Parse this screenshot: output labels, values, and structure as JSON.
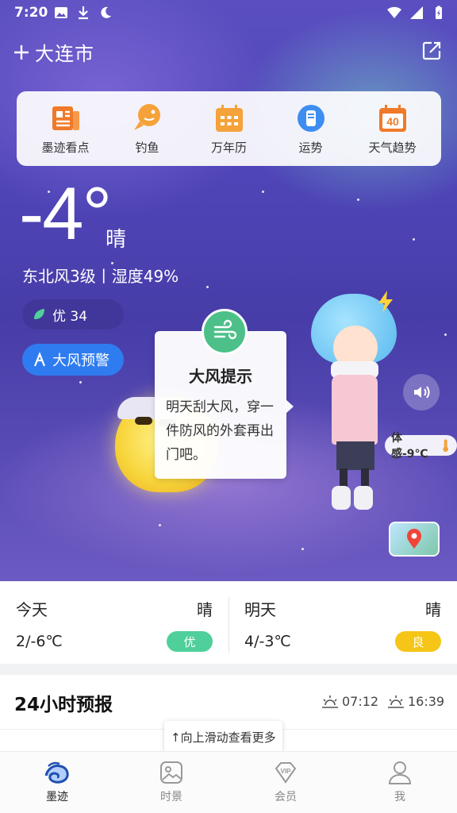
{
  "status_bar": {
    "time": "7:20"
  },
  "header": {
    "city": "大连市"
  },
  "shortcuts": [
    {
      "label": "墨迹看点",
      "icon": "news-icon"
    },
    {
      "label": "钓鱼",
      "icon": "fish-icon"
    },
    {
      "label": "万年历",
      "icon": "calendar-icon"
    },
    {
      "label": "运势",
      "icon": "fortune-icon"
    },
    {
      "label": "天气趋势",
      "icon": "trend-40-icon"
    }
  ],
  "shortcut_badge": "40",
  "current": {
    "temperature": "-4°",
    "condition": "晴",
    "wind_humidity": "东北风3级丨湿度49%",
    "aqi": "优 34",
    "alert": "大风预警",
    "feels_like": "体感-9℃"
  },
  "tip": {
    "title": "大风提示",
    "body": "明天刮大风，穿一件防风的外套再出门吧。"
  },
  "forecast": {
    "today": {
      "day": "今天",
      "condition": "晴",
      "range": "2/-6℃",
      "aqi": "优",
      "aqi_color": "#4fcf9a"
    },
    "tomorrow": {
      "day": "明天",
      "condition": "晴",
      "range": "4/-3℃",
      "aqi": "良",
      "aqi_color": "#f5c518"
    }
  },
  "hourly": {
    "title": "24小时预报",
    "sunrise": "07:12",
    "sunset": "16:39",
    "swipe_hint": "↑向上滑动查看更多"
  },
  "nav": [
    {
      "label": "墨迹",
      "icon": "moji-logo-icon",
      "active": true
    },
    {
      "label": "时景",
      "icon": "picture-icon",
      "active": false
    },
    {
      "label": "会员",
      "icon": "vip-icon",
      "active": false
    },
    {
      "label": "我",
      "icon": "profile-icon",
      "active": false
    }
  ],
  "colors": {
    "accent_blue": "#2f7cf0",
    "tip_green": "#4dc08a",
    "aqi_good": "#4fcf9a",
    "aqi_moderate": "#f5c518",
    "icon_orange": "#f07a2a"
  }
}
